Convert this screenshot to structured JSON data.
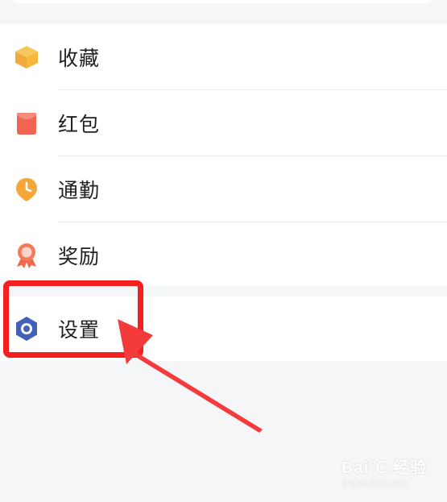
{
  "menu": {
    "items": [
      {
        "label": "收藏",
        "icon": "box-icon",
        "color": "#f6b73c"
      },
      {
        "label": "红包",
        "icon": "red-envelope-icon",
        "color": "#f06451"
      },
      {
        "label": "通勤",
        "icon": "clock-pin-icon",
        "color": "#f4a63a"
      },
      {
        "label": "奖励",
        "icon": "medal-icon",
        "color": "#f06b4d"
      }
    ],
    "settings": {
      "label": "设置",
      "icon": "hexagon-settings-icon",
      "color": "#4160b8"
    }
  },
  "annotation": {
    "box_color": "#f41f1f",
    "arrow_color": "#f43a3a"
  },
  "watermark": {
    "brand": "Bai℃ 经验",
    "url": "jingyan.baidu.com"
  }
}
